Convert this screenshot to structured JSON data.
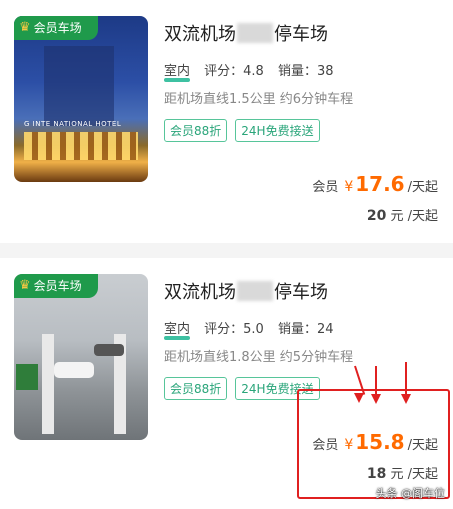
{
  "listings": [
    {
      "badge": "会员车场",
      "title_prefix": "双流机场",
      "title_suffix": "停车场",
      "indoor": "室内",
      "rating": "评分：4.8",
      "sales": "销量：38",
      "distance": "距机场直线1.5公里 约6分钟车程",
      "tags": [
        "会员88折",
        "24H免费接送"
      ],
      "vip_label": "会员",
      "yen": "¥",
      "price": "17.6",
      "price_unit": "/天起",
      "orig_value": "20",
      "orig_unit": " 元 /天起",
      "hotel_sign": "G INTE NATIONAL HOTEL"
    },
    {
      "badge": "会员车场",
      "title_prefix": "双流机场",
      "title_suffix": "停车场",
      "indoor": "室内",
      "rating": "评分：5.0",
      "sales": "销量：24",
      "distance": "距机场直线1.8公里 约5分钟车程",
      "tags": [
        "会员88折",
        "24H免费接送"
      ],
      "vip_label": "会员",
      "yen": "¥",
      "price": "15.8",
      "price_unit": "/天起",
      "orig_value": "18",
      "orig_unit": " 元 /天起"
    }
  ],
  "watermark": "头条 @阁车位",
  "colors": {
    "accent_orange": "#ff6a00",
    "badge_green": "#1f9a4b",
    "tag_green": "#2aa57a",
    "annotation_red": "#e02020"
  }
}
